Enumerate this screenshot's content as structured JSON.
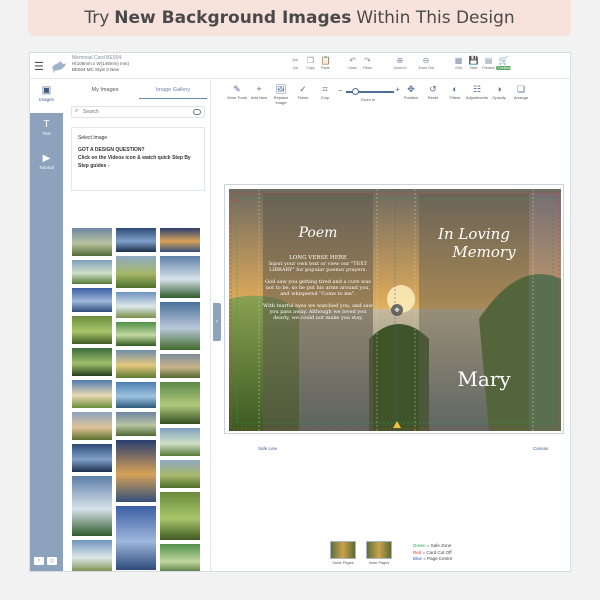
{
  "banner": {
    "prefix": "Try",
    "bold": "New Background Images",
    "suffix": "Within This Design"
  },
  "header": {
    "card_title": "Memorial Card BE504",
    "card_size": "H(106mm x W(148mm) mm)",
    "card_style": "BE504 MC Style 3 New"
  },
  "top_tools": [
    {
      "id": "cut",
      "label": "Cut",
      "icon": "scissors-icon",
      "glyph": "✂"
    },
    {
      "id": "copy",
      "label": "Copy",
      "icon": "copy-icon",
      "glyph": "❐"
    },
    {
      "id": "paste",
      "label": "Paste",
      "icon": "paste-icon",
      "glyph": "📋"
    },
    {
      "id": "undo",
      "label": "Undo",
      "icon": "undo-icon",
      "glyph": "↶"
    },
    {
      "id": "redo",
      "label": "Redo",
      "icon": "redo-icon",
      "glyph": "↷"
    },
    {
      "id": "zoom-in",
      "label": "Zoom In",
      "icon": "zoom-in-icon",
      "glyph": "⊕"
    },
    {
      "id": "zoom-out",
      "label": "Zoom Out",
      "icon": "zoom-out-icon",
      "glyph": "⊖"
    },
    {
      "id": "grid",
      "label": "Grid",
      "icon": "grid-icon",
      "glyph": "▦"
    },
    {
      "id": "save",
      "label": "Save",
      "icon": "save-icon",
      "glyph": "💾"
    },
    {
      "id": "preview",
      "label": "Preview",
      "icon": "preview-icon",
      "glyph": "▤"
    },
    {
      "id": "continue",
      "label": "Continue",
      "icon": "cart-icon",
      "glyph": "🛒"
    }
  ],
  "left_nav": [
    {
      "label": "Images",
      "icon": "image-icon",
      "glyph": "▣"
    },
    {
      "label": "Text",
      "icon": "text-icon",
      "glyph": "T"
    },
    {
      "label": "Tutorial",
      "icon": "video-icon",
      "glyph": "▶"
    }
  ],
  "left_foot": [
    "?",
    "Q"
  ],
  "panel": {
    "tabs": [
      "My Images",
      "Image Gallery"
    ],
    "active_tab": "Image Gallery",
    "search_placeholder": "Search",
    "select_image": "Select Image",
    "question": "GOT A DESIGN QUESTION?",
    "help": "Click on the Videos icon & watch quick Step By Step guides -"
  },
  "edit_tools": [
    {
      "label": "More Tools",
      "icon": "more-tools-icon",
      "glyph": "✎"
    },
    {
      "label": "Add New",
      "icon": "add-icon",
      "glyph": "+"
    },
    {
      "label": "Replace Image",
      "icon": "replace-image-icon",
      "glyph": "🖼"
    },
    {
      "label": "Finish",
      "icon": "finish-icon",
      "glyph": "✓"
    },
    {
      "label": "Crop",
      "icon": "crop-icon",
      "glyph": "⌗"
    }
  ],
  "zoom_label": "Zoom In",
  "edit_tools2": [
    {
      "label": "Position",
      "icon": "position-icon",
      "glyph": "✥"
    },
    {
      "label": "Reset",
      "icon": "reset-icon",
      "glyph": "↺"
    },
    {
      "label": "Filters",
      "icon": "filters-icon",
      "glyph": "◐"
    },
    {
      "label": "Adjustments",
      "icon": "adjustments-icon",
      "glyph": "☷"
    },
    {
      "label": "Opacity",
      "icon": "opacity-icon",
      "glyph": "◑"
    },
    {
      "label": "Arrange",
      "icon": "arrange-icon",
      "glyph": "❏"
    }
  ],
  "design": {
    "poem_title": "Poem",
    "verse_title": "LONG VERSE HERE",
    "verse_intro": "Input your own text or view our \"TEXT LIBRARY\" for popular poems/ prayers.",
    "verse_1": "God saw you getting tired and a cure was not to be, so he put his arms around you, and whispered \"Come to me\".",
    "verse_2": "With tearful eyes we watched you, and saw you pass away. Although we loved you dearly, we could not make you stay.",
    "in_loving": "In Loving",
    "memory": "Memory",
    "name": "Mary"
  },
  "labels": {
    "safe_line": "Safe Line",
    "canvas": "Canvas"
  },
  "pages": [
    "Outer Pages",
    "Inner Pages"
  ],
  "legend": [
    {
      "color": "Green",
      "text": "= Safe Zone",
      "cls": "g"
    },
    {
      "color": "Red",
      "text": "= Card Cut Off",
      "cls": "r"
    },
    {
      "color": "Blue",
      "text": "= Page Centre",
      "cls": "b"
    }
  ],
  "colors": {
    "accent": "#8da2bd",
    "brand_blue": "#4e6d99",
    "continue_green": "#59a766"
  }
}
